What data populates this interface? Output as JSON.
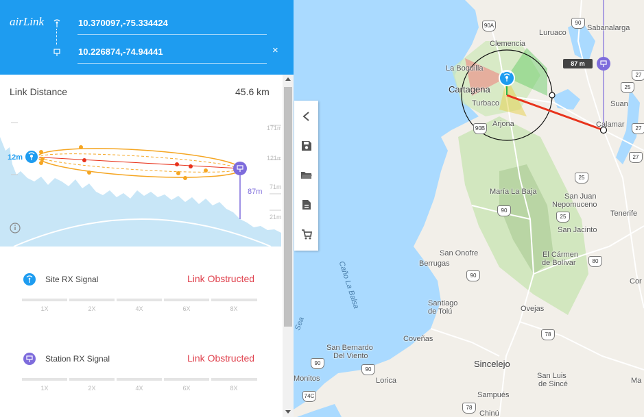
{
  "app": {
    "brand": "airLink"
  },
  "header": {
    "site_coord": "10.370097,-75.334424",
    "station_coord": "10.226874,-74.94441",
    "close_glyph": "×"
  },
  "link": {
    "distance_label": "Link Distance",
    "distance_value": "45.6 km"
  },
  "profile": {
    "site_height": "12m",
    "station_height": "87m",
    "right_ticks": [
      "171m",
      "121m",
      "71m",
      "21m"
    ]
  },
  "signals": [
    {
      "label": "Site RX Signal",
      "status": "Link Obstructed",
      "scale": [
        "1X",
        "2X",
        "4X",
        "6X",
        "8X"
      ]
    },
    {
      "label": "Station RX Signal",
      "status": "Link Obstructed",
      "scale": [
        "1X",
        "2X",
        "4X",
        "6X",
        "8X"
      ]
    }
  ],
  "map": {
    "distance_tag": "87 m",
    "places": {
      "luruaco": "Luruaco",
      "sabanalarga": "Sabanalarga",
      "clemencia": "Clemencia",
      "la_boquilla": "La Boquilla",
      "cartagena": "Cartagena",
      "turbaco": "Turbaco",
      "arjona": "Arjona",
      "suan": "Suan",
      "calamar": "Calamar",
      "maria_la_baja": "María La Baja",
      "san_juan": "San Juan",
      "nepomuceno": "Nepomuceno",
      "tenerife": "Tenerife",
      "san_jacinto": "San Jacinto",
      "san_onofre": "San Onofre",
      "berrugas": "Berrugas",
      "el_carmen": "El Cármen",
      "de_bolivar": "de Bolívar",
      "cano_la_balsa": "Caño La Balsa",
      "santiago": "Santiago",
      "de_tolu": "de Tolú",
      "ovejas": "Ovejas",
      "covenas": "Coveñas",
      "san_bernardo": "San Bernardo",
      "del_viento": "Del Viento",
      "monitos": "Monitos",
      "lorica": "Lorica",
      "sincelejo": "Sincelejo",
      "san_luis": "San Luis",
      "de_since": "de Sincé",
      "sampues": "Sampués",
      "chinu": "Chinú",
      "cor": "Cor",
      "ma": "Ma",
      "sea": "Sea"
    },
    "roads": [
      "90A",
      "90",
      "25",
      "27",
      "90B",
      "90",
      "25",
      "80",
      "90",
      "78",
      "90",
      "74C",
      "78",
      "27",
      "25",
      "27",
      "90"
    ]
  },
  "toolbar": {
    "items": [
      "chevron-left-icon",
      "save-icon",
      "folder-open-icon",
      "document-icon",
      "cart-icon"
    ]
  },
  "colors": {
    "header": "#1e9cf0",
    "obstructed": "#e0434f",
    "link_line": "#e8331c",
    "site_icon": "#1e9cf0",
    "station_icon": "#7e6cdc"
  }
}
